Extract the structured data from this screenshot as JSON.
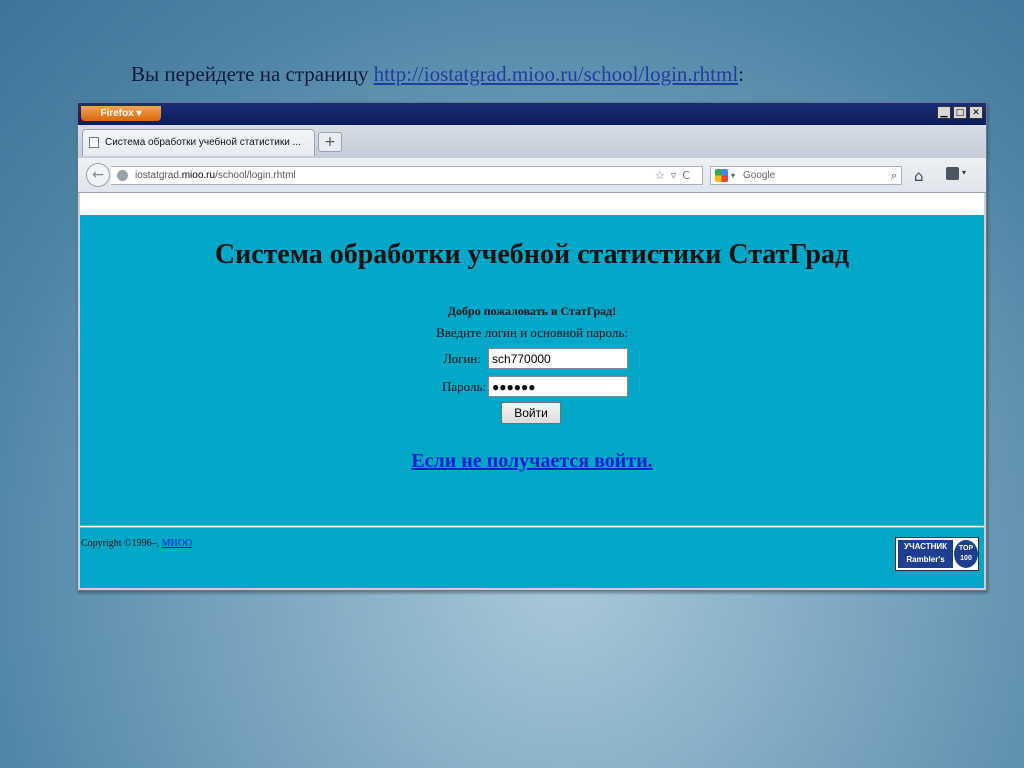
{
  "slide": {
    "caption_prefix": "Вы перейдете на страницу ",
    "caption_link": "http://iostatgrad.mioo.ru/school/login.rhtml",
    "caption_suffix": ":"
  },
  "browser": {
    "menu_button": "Firefox ▾",
    "window_controls": [
      "▁",
      "□",
      "✕"
    ],
    "tab_title": "Система обработки учебной статистики ...",
    "new_tab": "+",
    "url_host": "iostatgrad.mioo.ru",
    "url_prefix": "iostatgrad.",
    "url_domain": "mioo.ru",
    "url_path": "/school/login.rhtml",
    "url_icons": "☆▿C",
    "search_placeholder": "Google",
    "search_icon": "⌕",
    "home_icon": "⌂"
  },
  "page": {
    "title": "Система обработки учебной статистики СтатГрад",
    "welcome": "Добро пожаловать в СтатГрад!",
    "instructions": "Введите логин и основной пароль:",
    "login_label": "Логин:",
    "login_value": "sch770000",
    "password_label": "Пароль:",
    "password_value": "●●●●●●",
    "submit_label": "Войти",
    "help_link": "Если не получается войти.",
    "copyright_prefix": "Copyright ©1996–, ",
    "copyright_link": "МИОО",
    "badge_line1": "УЧАСТНИК",
    "badge_line2": "Rambler's",
    "badge_top": "TOP",
    "badge_100": "100"
  }
}
